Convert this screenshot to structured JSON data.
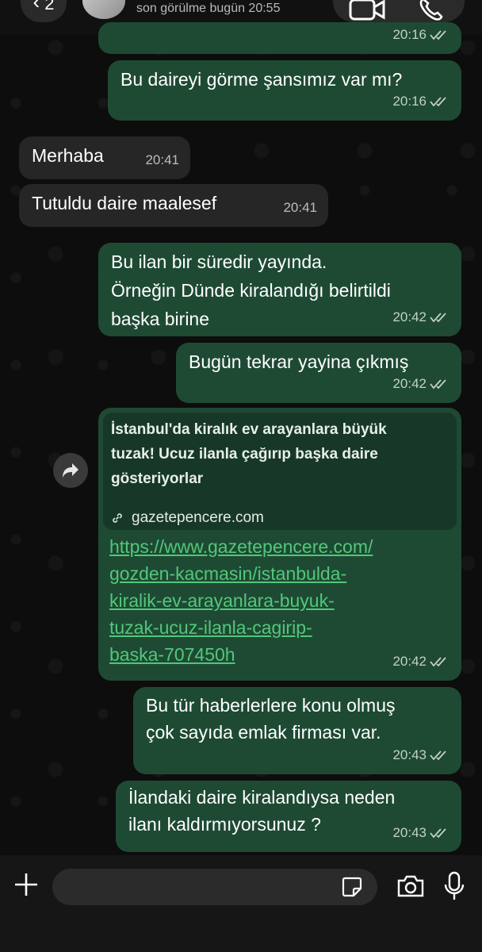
{
  "header": {
    "back_count": "2",
    "last_seen": "son görülme bugün 20:55"
  },
  "messages": [
    {
      "id": "m0",
      "direction": "out",
      "text": "",
      "time": "20:16"
    },
    {
      "id": "m1",
      "direction": "out",
      "text": "Bu daireyi görme şansımız var mı?",
      "time": "20:16"
    },
    {
      "id": "m2",
      "direction": "in",
      "text": "Merhaba",
      "time": "20:41"
    },
    {
      "id": "m3",
      "direction": "in",
      "text": "Tutuldu daire maalesef",
      "time": "20:41"
    },
    {
      "id": "m4",
      "direction": "out",
      "lines": [
        "Bu ilan bir süredir yayında.",
        "Örneğin Dünde kiralandığı belirtildi",
        "başka birine"
      ],
      "time": "20:42"
    },
    {
      "id": "m5",
      "direction": "out",
      "text": "Bugün tekrar yayina çıkmış",
      "time": "20:42"
    },
    {
      "id": "m6",
      "direction": "out",
      "preview_title_lines": [
        "İstanbul'da kiralık ev arayanlara büyük",
        "tuzak! Ucuz ilanla çağırıp başka daire",
        "gösteriyorlar"
      ],
      "preview_domain": "gazetepencere.com",
      "link_lines": [
        "https://www.gazetepencere.com/",
        "gozden-kacmasin/istanbulda-",
        "kiralik-ev-arayanlara-buyuk-",
        "tuzak-ucuz-ilanla-cagirip-",
        "baska-707450h"
      ],
      "time": "20:42"
    },
    {
      "id": "m7",
      "direction": "out",
      "lines": [
        "Bu tür haberlerlere konu olmuş",
        "çok sayıda emlak firması var."
      ],
      "time": "20:43"
    },
    {
      "id": "m8",
      "direction": "out",
      "lines": [
        "İlandaki daire kiralandıysa neden",
        "ilanı kaldırmıyorsunuz ?"
      ],
      "time": "20:43"
    }
  ],
  "input": {
    "placeholder": "",
    "value": ""
  },
  "icons": {
    "back": "chevron-left-icon",
    "video": "video-call-icon",
    "phone": "phone-icon",
    "forward": "forward-icon",
    "link": "link-icon",
    "plus": "plus-icon",
    "sticker": "sticker-icon",
    "camera": "camera-icon",
    "mic": "microphone-icon",
    "ticks": "double-check-icon"
  },
  "colors": {
    "outgoing_bubble": "#1e4a34",
    "incoming_bubble": "#262626",
    "link": "#52c77a",
    "background": "#0d0d0d"
  }
}
